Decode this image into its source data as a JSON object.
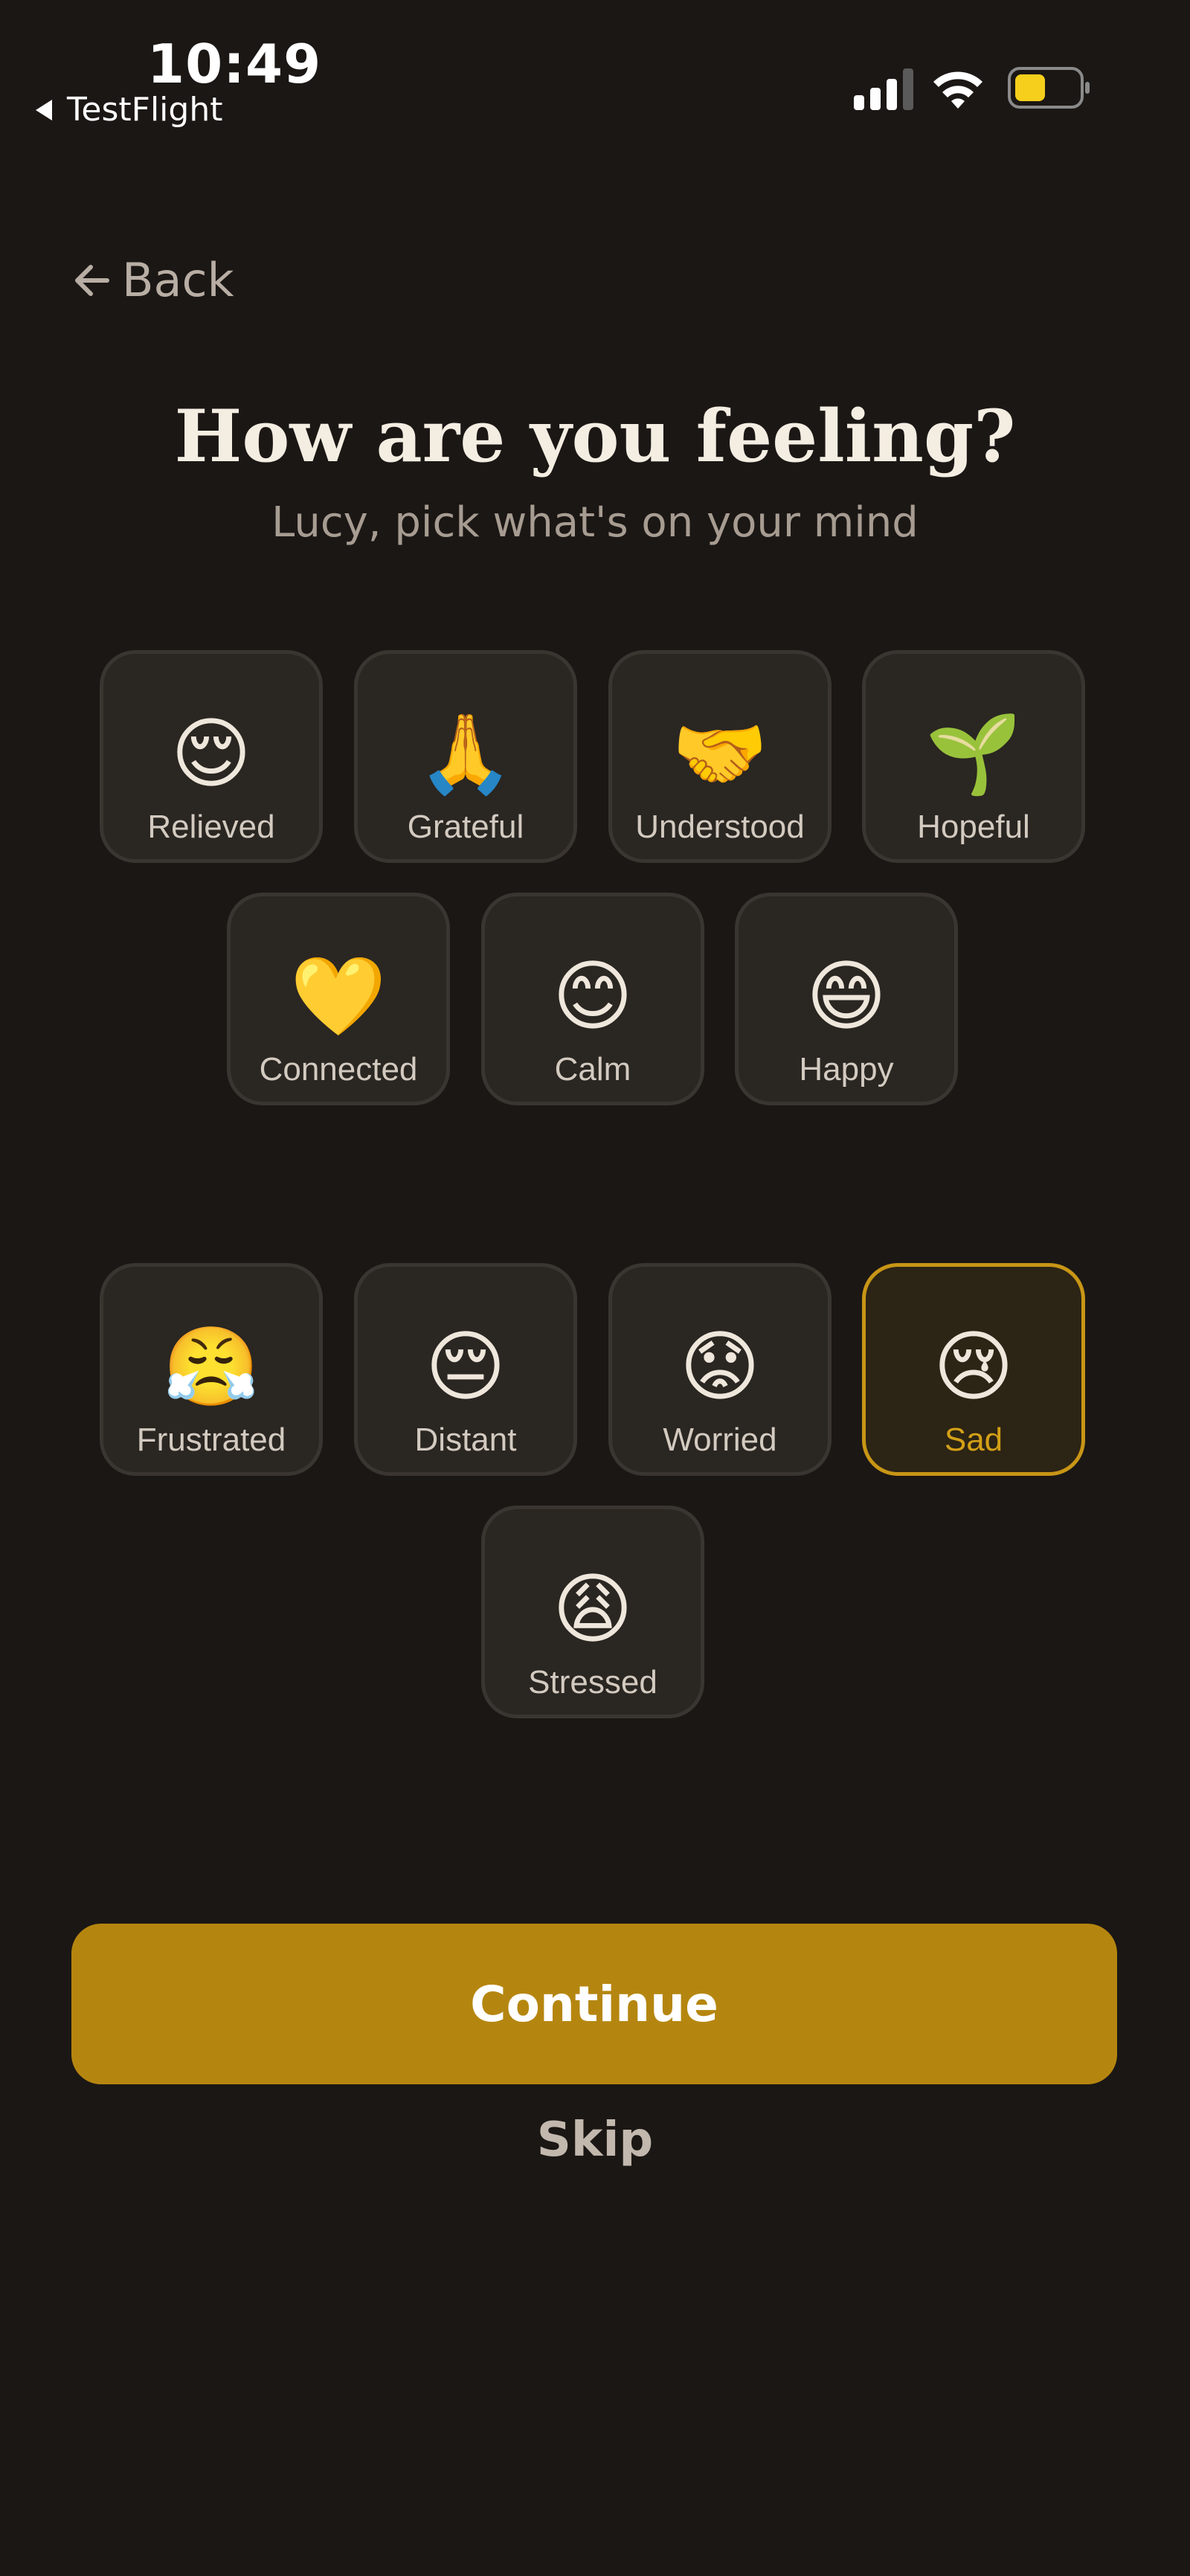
{
  "status_bar": {
    "time": "10:49",
    "back_app": "TestFlight",
    "icons": [
      "cellular-signal-icon",
      "wifi-icon",
      "battery-icon"
    ]
  },
  "nav": {
    "back_label": "Back"
  },
  "header": {
    "title": "How are you feeling?",
    "subtitle": "Lucy, pick what's on your mind"
  },
  "positive_moods": [
    {
      "emoji": "😌",
      "label": "Relieved"
    },
    {
      "emoji": "🙏",
      "label": "Grateful"
    },
    {
      "emoji": "🤝",
      "label": "Understood"
    },
    {
      "emoji": "🌱",
      "label": "Hopeful"
    },
    {
      "emoji": "💛",
      "label": "Connected"
    },
    {
      "emoji": "😊",
      "label": "Calm"
    },
    {
      "emoji": "😄",
      "label": "Happy"
    }
  ],
  "negative_moods": [
    {
      "emoji": "😤",
      "label": "Frustrated"
    },
    {
      "emoji": "😔",
      "label": "Distant"
    },
    {
      "emoji": "😟",
      "label": "Worried"
    },
    {
      "emoji": "😢",
      "label": "Sad",
      "selected": true
    },
    {
      "emoji": "😩",
      "label": "Stressed"
    }
  ],
  "actions": {
    "continue_label": "Continue",
    "skip_label": "Skip"
  },
  "colors": {
    "background": "#1b1715",
    "accent": "#b5860f",
    "selected_border": "#c89616"
  }
}
